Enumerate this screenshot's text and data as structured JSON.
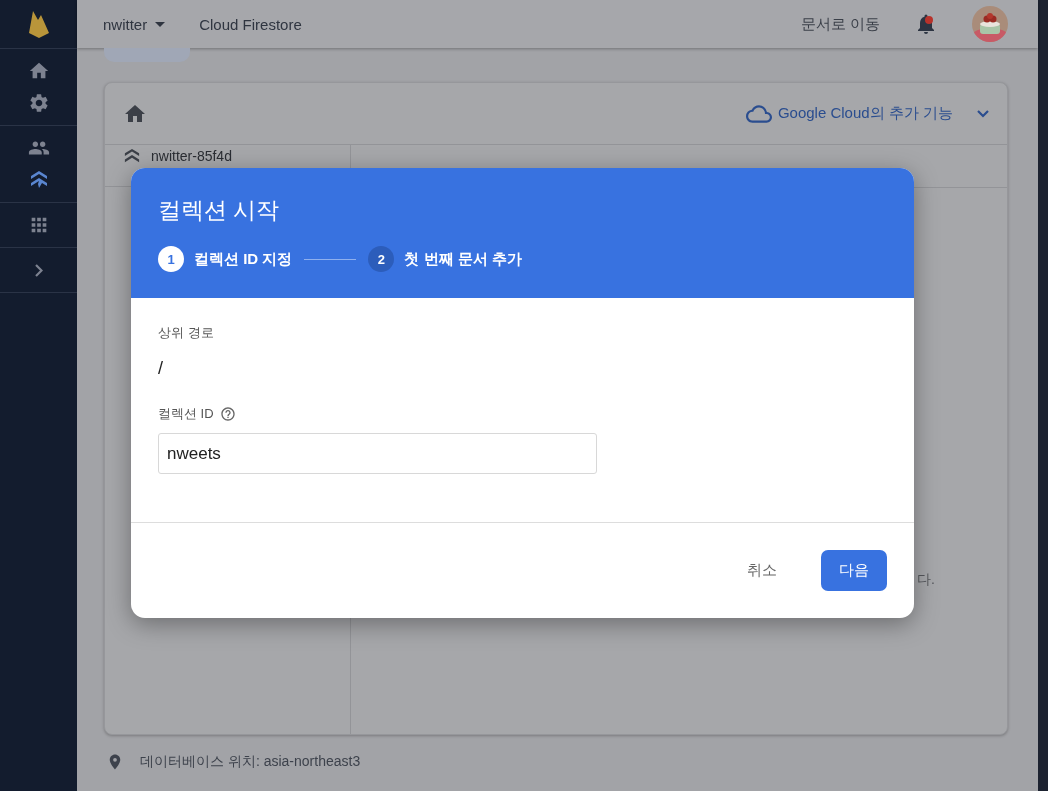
{
  "sidebar": {
    "items": [
      {
        "kind": "home",
        "selected": false
      },
      {
        "kind": "settings",
        "selected": false
      },
      {
        "kind": "users",
        "selected": false
      },
      {
        "kind": "firestore",
        "selected": true
      },
      {
        "kind": "apps",
        "selected": false
      },
      {
        "kind": "expand",
        "selected": false
      }
    ]
  },
  "header": {
    "project": "nwitter",
    "product": "Cloud Firestore",
    "docs_link": "문서로 이동"
  },
  "card": {
    "cloud_link": "Google Cloud의 추가 기능",
    "root": "nwitter-85f4d",
    "hint_fragment": "다."
  },
  "location": "데이터베이스 위치: asia-northeast3",
  "dialog": {
    "title": "컬렉션 시작",
    "steps": [
      {
        "number": "1",
        "label": "컬렉션 ID 지정",
        "selected": true
      },
      {
        "number": "2",
        "label": "첫 번째 문서 추가",
        "selected": false
      }
    ],
    "parent_path_label": "상위 경로",
    "parent_path": "/",
    "collection_id_label": "컬렉션 ID",
    "collection_id": "nweets",
    "buttons": [
      {
        "label": "취소",
        "kind": "text"
      },
      {
        "label": "다음",
        "kind": "primary"
      }
    ]
  }
}
